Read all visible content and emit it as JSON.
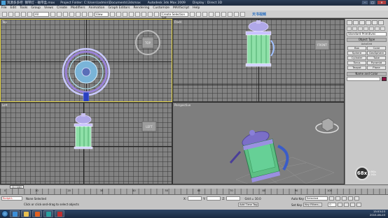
{
  "title_bar": {
    "segments": [
      "资源多多吧",
      "钢琴灯 - 磁带盒.max",
      "Project Folder: C:\\Users\\admin\\Documents\\3dsmax",
      "Autodesk 3ds Max 2009",
      "Display : Direct 3D"
    ],
    "minimize": "–",
    "maximize": "□",
    "close": "✕"
  },
  "menu": [
    "File",
    "Edit",
    "Tools",
    "Group",
    "Views",
    "Create",
    "Modifiers",
    "Animation",
    "Graph Editors",
    "Rendering",
    "Customize",
    "MAXScript",
    "Help"
  ],
  "toolbar": {
    "selection_filter": "All",
    "reference_coord": "View",
    "named_selection": "Create Selection Set"
  },
  "watermark": "天书视频",
  "viewports": {
    "top": "Top",
    "front": "Front",
    "left": "Left",
    "perspective": "Perspective",
    "viewcube_top": "TOP",
    "viewcube_front": "FRONT",
    "viewcube_left": "LEFT"
  },
  "command_panel": {
    "category": "Standard Primitives",
    "object_type_title": "Object Type",
    "autogrid": "AutoGrid",
    "buttons": [
      "Box",
      "Cone",
      "Sphere",
      "GeoSphere",
      "Cylinder",
      "Tube",
      "Torus",
      "Pyramid",
      "Teapot",
      "Plane"
    ],
    "name_color_title": "Name and Color",
    "object_color": "#8a1040"
  },
  "timeline": {
    "slider": "0 / 100",
    "ticks": [
      "0",
      "10",
      "20",
      "30",
      "40",
      "50",
      "60",
      "70",
      "80",
      "90",
      "100"
    ]
  },
  "status": {
    "script_field": "Script L",
    "selection": "None Selected",
    "prompt": "Click or click-and-drag to select objects",
    "x_label": "X:",
    "y_label": "Y:",
    "z_label": "Z:",
    "grid": "Grid = 10.0",
    "add_time_tag": "Add Time Tag",
    "auto_key": "Auto Key",
    "selected": "Selected",
    "set_key": "Set Key",
    "key_filters": "Key Filters...",
    "frame": "0"
  },
  "overlay": {
    "fps": "68x",
    "rate_top": "0.6K/s",
    "rate_bottom": "0.1K/s"
  },
  "clock": {
    "time": "15:53:23",
    "date": "2015-06-03"
  }
}
